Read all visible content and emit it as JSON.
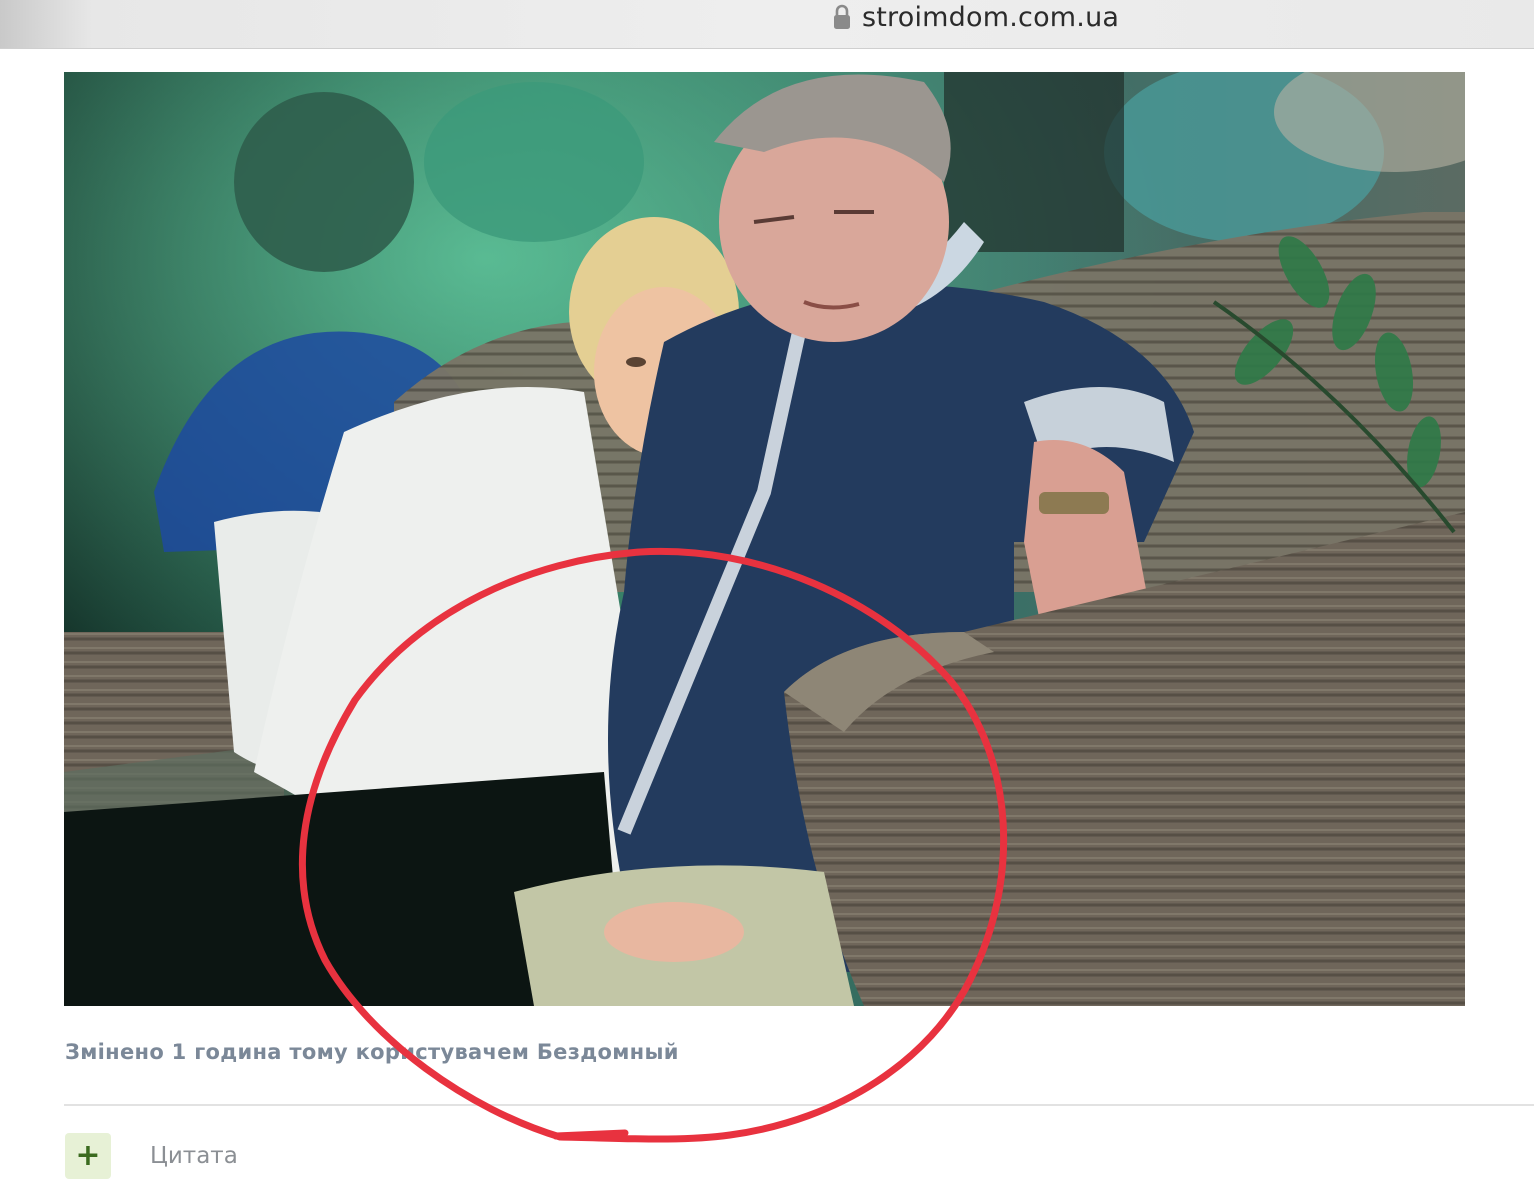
{
  "browser": {
    "url": "stroimdom.com.ua",
    "lock_icon": "lock-icon"
  },
  "post": {
    "edited_note": "Змінено 1 година тому користувачем Бездомный",
    "quote_button_icon": "plus-icon",
    "quote_button_symbol": "+",
    "quote_label": "Цитата"
  },
  "annotation": {
    "shape": "hand-drawn circle",
    "color": "#e8323f"
  },
  "colors": {
    "edited_note": "#7b8898",
    "quote_button_bg": "#e7f1d6",
    "quote_button_fg": "#3b6b1f",
    "quote_label": "#8b8f94"
  }
}
